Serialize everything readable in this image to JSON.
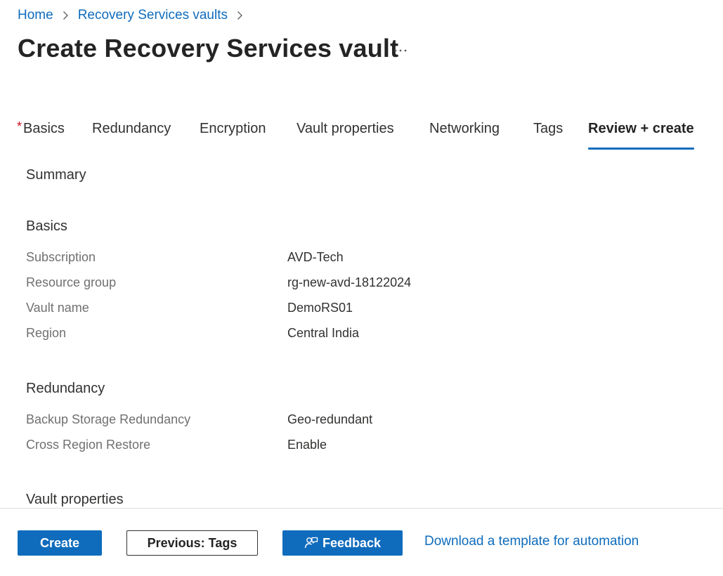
{
  "breadcrumb": {
    "home": "Home",
    "vaults": "Recovery Services vaults"
  },
  "page": {
    "title": "Create Recovery Services vault",
    "more_icon": "more-horizontal-icon"
  },
  "tabs": {
    "required_marker": "*",
    "items": [
      "Basics",
      "Redundancy",
      "Encryption",
      "Vault properties",
      "Networking",
      "Tags",
      "Review + create"
    ],
    "active": "Review + create"
  },
  "summary": {
    "heading": "Summary",
    "basics": {
      "heading": "Basics",
      "rows": [
        {
          "label": "Subscription",
          "value": "AVD-Tech"
        },
        {
          "label": "Resource group",
          "value": "rg-new-avd-18122024"
        },
        {
          "label": "Vault name",
          "value": "DemoRS01"
        },
        {
          "label": "Region",
          "value": "Central India"
        }
      ]
    },
    "redundancy": {
      "heading": "Redundancy",
      "rows": [
        {
          "label": "Backup Storage Redundancy",
          "value": "Geo-redundant"
        },
        {
          "label": "Cross Region Restore",
          "value": "Enable"
        }
      ]
    },
    "vault_properties": {
      "heading": "Vault properties"
    }
  },
  "footer": {
    "create": "Create",
    "previous": "Previous: Tags",
    "feedback": "Feedback",
    "feedback_icon": "person-feedback-icon",
    "download": "Download a template for automation"
  },
  "colors": {
    "accent": "#0f6cbd",
    "required": "#c50f1f",
    "label": "#707070",
    "text": "#323130"
  }
}
